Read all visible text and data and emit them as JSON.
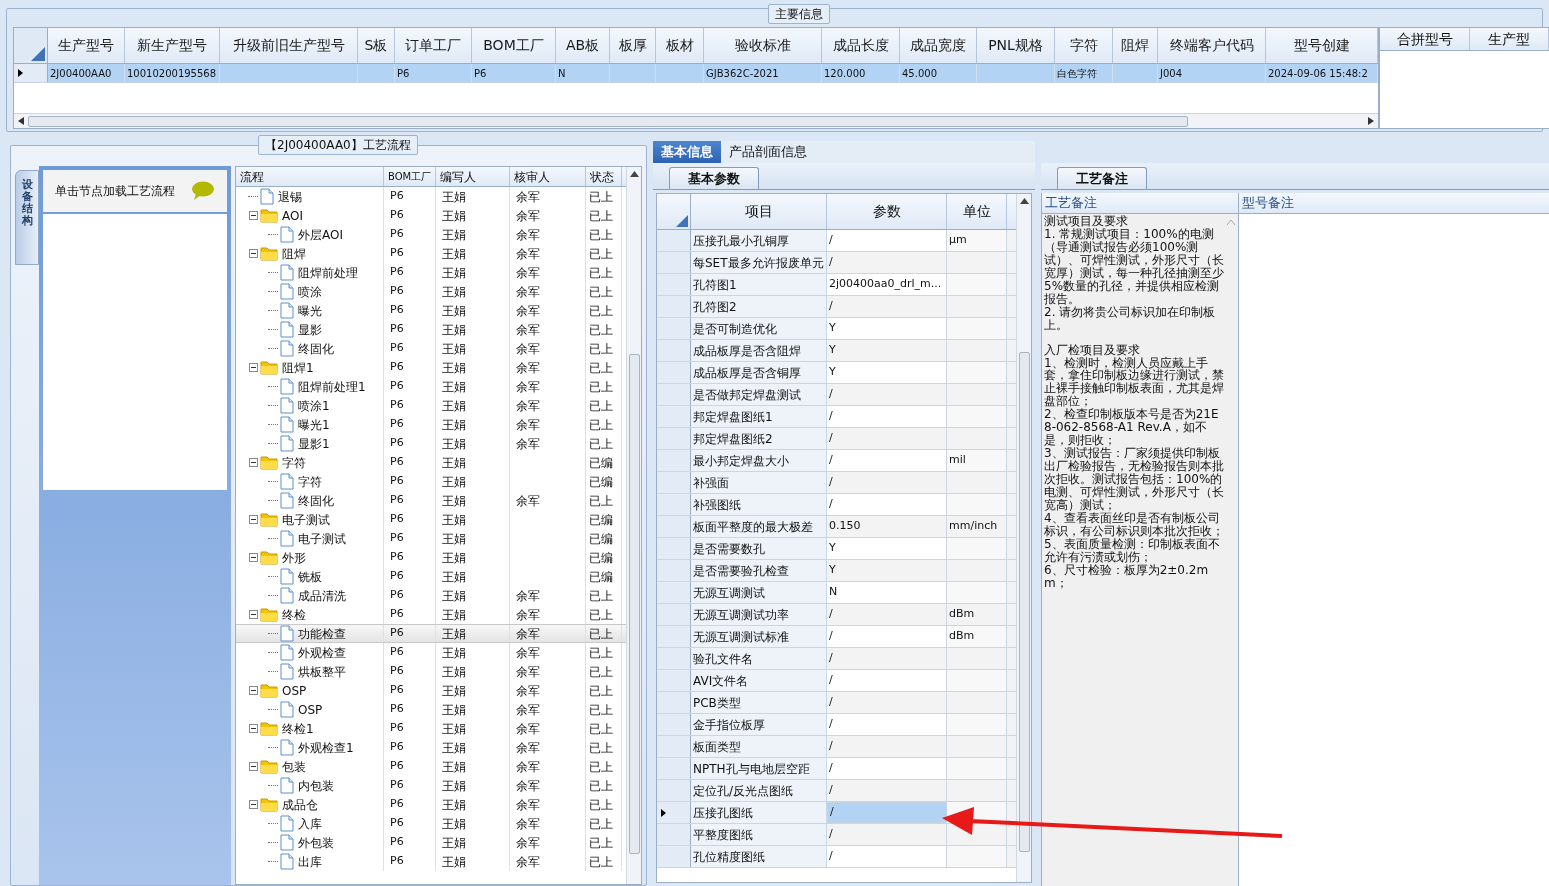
{
  "main_info": {
    "title": "主要信息",
    "columns": [
      "生产型号",
      "新生产型号",
      "升级前旧生产型号",
      "S板",
      "订单工厂",
      "BOM工厂",
      "AB板",
      "板厚",
      "板材",
      "验收标准",
      "成品长度",
      "成品宽度",
      "PNL规格",
      "字符",
      "阻焊",
      "终端客户代码",
      "型号创建"
    ],
    "rows": [
      {
        "selected": true,
        "cells": [
          "2J00400AA0",
          "10010200195568",
          "",
          "",
          "P6",
          "P6",
          "N",
          "",
          "",
          "GJB362C-2021",
          "120.000",
          "45.000",
          "",
          "白色字符",
          "",
          "J004",
          "2024-09-06 15:48:2"
        ]
      }
    ],
    "side_columns": [
      "合拼型号",
      "生产型"
    ]
  },
  "process_flow": {
    "title": "【2J00400AA0】工艺流程",
    "side_tab": "设备结构",
    "hint": "单击节点加载工艺流程",
    "columns": [
      "流程",
      "BOM工厂",
      "编写人",
      "核审人",
      "状态"
    ],
    "items": [
      {
        "kind": "file",
        "name": "退锡",
        "bom": "P6",
        "writer": "王娟",
        "reviewer": "余军",
        "status": "已上",
        "selected": false
      },
      {
        "kind": "folder",
        "expanded": true,
        "name": "AOI",
        "bom": "P6",
        "writer": "王娟",
        "reviewer": "余军",
        "status": "已上",
        "selected": false,
        "children": [
          {
            "kind": "file",
            "name": "外层AOI",
            "bom": "P6",
            "writer": "王娟",
            "reviewer": "余军",
            "status": "已上",
            "selected": false
          }
        ]
      },
      {
        "kind": "folder",
        "expanded": true,
        "name": "阻焊",
        "bom": "P6",
        "writer": "王娟",
        "reviewer": "余军",
        "status": "已上",
        "selected": false,
        "children": [
          {
            "kind": "file",
            "name": "阻焊前处理",
            "bom": "P6",
            "writer": "王娟",
            "reviewer": "余军",
            "status": "已上",
            "selected": false
          },
          {
            "kind": "file",
            "name": "喷涂",
            "bom": "P6",
            "writer": "王娟",
            "reviewer": "余军",
            "status": "已上",
            "selected": false
          },
          {
            "kind": "file",
            "name": "曝光",
            "bom": "P6",
            "writer": "王娟",
            "reviewer": "余军",
            "status": "已上",
            "selected": false
          },
          {
            "kind": "file",
            "name": "显影",
            "bom": "P6",
            "writer": "王娟",
            "reviewer": "余军",
            "status": "已上",
            "selected": false
          },
          {
            "kind": "file",
            "name": "终固化",
            "bom": "P6",
            "writer": "王娟",
            "reviewer": "余军",
            "status": "已上",
            "selected": false
          }
        ]
      },
      {
        "kind": "folder",
        "expanded": true,
        "name": "阻焊1",
        "bom": "P6",
        "writer": "王娟",
        "reviewer": "余军",
        "status": "已上",
        "selected": false,
        "children": [
          {
            "kind": "file",
            "name": "阻焊前处理1",
            "bom": "P6",
            "writer": "王娟",
            "reviewer": "余军",
            "status": "已上",
            "selected": false
          },
          {
            "kind": "file",
            "name": "喷涂1",
            "bom": "P6",
            "writer": "王娟",
            "reviewer": "余军",
            "status": "已上",
            "selected": false
          },
          {
            "kind": "file",
            "name": "曝光1",
            "bom": "P6",
            "writer": "王娟",
            "reviewer": "余军",
            "status": "已上",
            "selected": false
          },
          {
            "kind": "file",
            "name": "显影1",
            "bom": "P6",
            "writer": "王娟",
            "reviewer": "余军",
            "status": "已上",
            "selected": false
          }
        ]
      },
      {
        "kind": "folder",
        "expanded": true,
        "name": "字符",
        "bom": "P6",
        "writer": "王娟",
        "status": "已编",
        "selected": false,
        "children": [
          {
            "kind": "file",
            "name": "字符",
            "bom": "P6",
            "writer": "王娟",
            "status": "已编",
            "selected": false
          },
          {
            "kind": "file",
            "name": "终固化",
            "bom": "P6",
            "writer": "王娟",
            "reviewer": "余军",
            "status": "已上",
            "selected": false
          }
        ]
      },
      {
        "kind": "folder",
        "expanded": true,
        "name": "电子测试",
        "bom": "P6",
        "writer": "王娟",
        "status": "已编",
        "selected": false,
        "children": [
          {
            "kind": "file",
            "name": "电子测试",
            "bom": "P6",
            "writer": "王娟",
            "status": "已编",
            "selected": false
          }
        ]
      },
      {
        "kind": "folder",
        "expanded": true,
        "name": "外形",
        "bom": "P6",
        "writer": "王娟",
        "status": "已编",
        "selected": false,
        "children": [
          {
            "kind": "file",
            "name": "铣板",
            "bom": "P6",
            "writer": "王娟",
            "status": "已编",
            "selected": false
          },
          {
            "kind": "file",
            "name": "成品清洗",
            "bom": "P6",
            "writer": "王娟",
            "reviewer": "余军",
            "status": "已上",
            "selected": false
          }
        ]
      },
      {
        "kind": "folder",
        "expanded": true,
        "name": "终检",
        "bom": "P6",
        "writer": "王娟",
        "reviewer": "余军",
        "status": "已上",
        "selected": false,
        "children": [
          {
            "kind": "file",
            "name": "功能检查",
            "bom": "P6",
            "writer": "王娟",
            "reviewer": "余军",
            "status": "已上",
            "selected": true
          },
          {
            "kind": "file",
            "name": "外观检查",
            "bom": "P6",
            "writer": "王娟",
            "reviewer": "余军",
            "status": "已上",
            "selected": false
          },
          {
            "kind": "file",
            "name": "烘板整平",
            "bom": "P6",
            "writer": "王娟",
            "reviewer": "余军",
            "status": "已上",
            "selected": false
          }
        ]
      },
      {
        "kind": "folder",
        "expanded": true,
        "name": "OSP",
        "bom": "P6",
        "writer": "王娟",
        "reviewer": "余军",
        "status": "已上",
        "selected": false,
        "children": [
          {
            "kind": "file",
            "name": "OSP",
            "bom": "P6",
            "writer": "王娟",
            "reviewer": "余军",
            "status": "已上",
            "selected": false
          }
        ]
      },
      {
        "kind": "folder",
        "expanded": true,
        "name": "终检1",
        "bom": "P6",
        "writer": "王娟",
        "reviewer": "余军",
        "status": "已上",
        "selected": false,
        "children": [
          {
            "kind": "file",
            "name": "外观检查1",
            "bom": "P6",
            "writer": "王娟",
            "reviewer": "余军",
            "status": "已上",
            "selected": false
          }
        ]
      },
      {
        "kind": "folder",
        "expanded": true,
        "name": "包装",
        "bom": "P6",
        "writer": "王娟",
        "reviewer": "余军",
        "status": "已上",
        "selected": false,
        "children": [
          {
            "kind": "file",
            "name": "内包装",
            "bom": "P6",
            "writer": "王娟",
            "reviewer": "余军",
            "status": "已上",
            "selected": false
          }
        ]
      },
      {
        "kind": "folder",
        "expanded": true,
        "name": "成品仓",
        "bom": "P6",
        "writer": "王娟",
        "reviewer": "余军",
        "status": "已上",
        "selected": false,
        "children": [
          {
            "kind": "file",
            "name": "入库",
            "bom": "P6",
            "writer": "王娟",
            "reviewer": "余军",
            "status": "已上",
            "selected": false
          },
          {
            "kind": "file",
            "name": "外包装",
            "bom": "P6",
            "writer": "王娟",
            "reviewer": "余军",
            "status": "已上",
            "selected": false
          },
          {
            "kind": "file",
            "name": "出库",
            "bom": "P6",
            "writer": "王娟",
            "reviewer": "余军",
            "status": "已上",
            "selected": false
          }
        ]
      }
    ]
  },
  "info_tabs": [
    {
      "label": "基本信息",
      "selected": true
    },
    {
      "label": "产品剖面信息",
      "selected": false
    }
  ],
  "basic_params": {
    "tab": "基本参数",
    "columns": [
      "项目",
      "参数",
      "单位"
    ],
    "rows": [
      {
        "item": "压接孔最小孔铜厚",
        "value": "/",
        "unit": "μm",
        "selected": false
      },
      {
        "item": "每SET最多允许报废单元",
        "value": "/",
        "selected": false
      },
      {
        "item": "孔符图1",
        "value": "2j00400aa0_drl_m...",
        "selected": false
      },
      {
        "item": "孔符图2",
        "value": "/",
        "selected": false
      },
      {
        "item": "是否可制造优化",
        "value": "Y",
        "selected": false
      },
      {
        "item": "成品板厚是否含阻焊",
        "value": "Y",
        "selected": false
      },
      {
        "item": "成品板厚是否含铜厚",
        "value": "Y",
        "selected": false
      },
      {
        "item": "是否做邦定焊盘测试",
        "value": "/",
        "selected": false
      },
      {
        "item": "邦定焊盘图纸1",
        "value": "/",
        "selected": false
      },
      {
        "item": "邦定焊盘图纸2",
        "value": "/",
        "selected": false
      },
      {
        "item": "最小邦定焊盘大小",
        "value": "/",
        "unit": "mil",
        "selected": false
      },
      {
        "item": "补强面",
        "value": "/",
        "selected": false
      },
      {
        "item": "补强图纸",
        "value": "/",
        "selected": false
      },
      {
        "item": "板面平整度的最大极差",
        "value": "0.150",
        "unit": "mm/inch",
        "selected": false
      },
      {
        "item": "是否需要数孔",
        "value": "Y",
        "selected": false
      },
      {
        "item": "是否需要验孔检查",
        "value": "Y",
        "selected": false
      },
      {
        "item": "无源互调测试",
        "value": "N",
        "selected": false
      },
      {
        "item": "无源互调测试功率",
        "value": "/",
        "unit": "dBm",
        "selected": false
      },
      {
        "item": "无源互调测试标准",
        "value": "/",
        "unit": "dBm",
        "selected": false
      },
      {
        "item": "验孔文件名",
        "value": "/",
        "selected": false
      },
      {
        "item": "AVI文件名",
        "value": "/",
        "selected": false
      },
      {
        "item": "PCB类型",
        "value": "/",
        "selected": false
      },
      {
        "item": "金手指位板厚",
        "value": "/",
        "selected": false
      },
      {
        "item": "板面类型",
        "value": "/",
        "selected": false
      },
      {
        "item": "NPTH孔与电地层空距",
        "value": "/",
        "selected": false
      },
      {
        "item": "定位孔/反光点图纸",
        "value": "/",
        "selected": false
      },
      {
        "item": "压接孔图纸",
        "value": "/",
        "selected": true
      },
      {
        "item": "平整度图纸",
        "value": "/",
        "selected": false
      },
      {
        "item": "孔位精度图纸",
        "value": "/",
        "selected": false
      }
    ]
  },
  "process_notes": {
    "tab": "工艺备注",
    "columns": [
      "工艺备注",
      "型号备注"
    ],
    "sections": [
      {
        "lines": [
          "测试项目及要求",
          "1.  常规测试项目：100%的电测（导通测试报告必须100%测试）、可焊性测试，外形尺寸（长宽厚）测试，每一种孔径抽测至少5%数量的孔径，并提供相应检测报告。",
          "2.  请勿将贵公司标识加在印制板上。"
        ]
      },
      {
        "lines": [
          "入厂检项目及要求",
          "1、检测时，检测人员应戴上手套，拿住印制板边缘进行测试，禁止裸手接触印制板表面，尤其是焊盘部位；",
          "2、检查印制板版本号是否为21E8-062-8568-A1 Rev.A，如不是，则拒收；",
          "3、测试报告：厂家须提供印制板出厂检验报告，无检验报告则本批次拒收。测试报告包括：100%的电测、可焊性测试，外形尺寸（长宽高）测试；",
          "4、查看表面丝印是否有制板公司标识，有公司标识则本批次拒收；",
          "5、表面质量检测：印制板表面不允许有污渍或划伤；",
          "6、尺寸检验：板厚为2±0.2mm；"
        ]
      }
    ]
  }
}
